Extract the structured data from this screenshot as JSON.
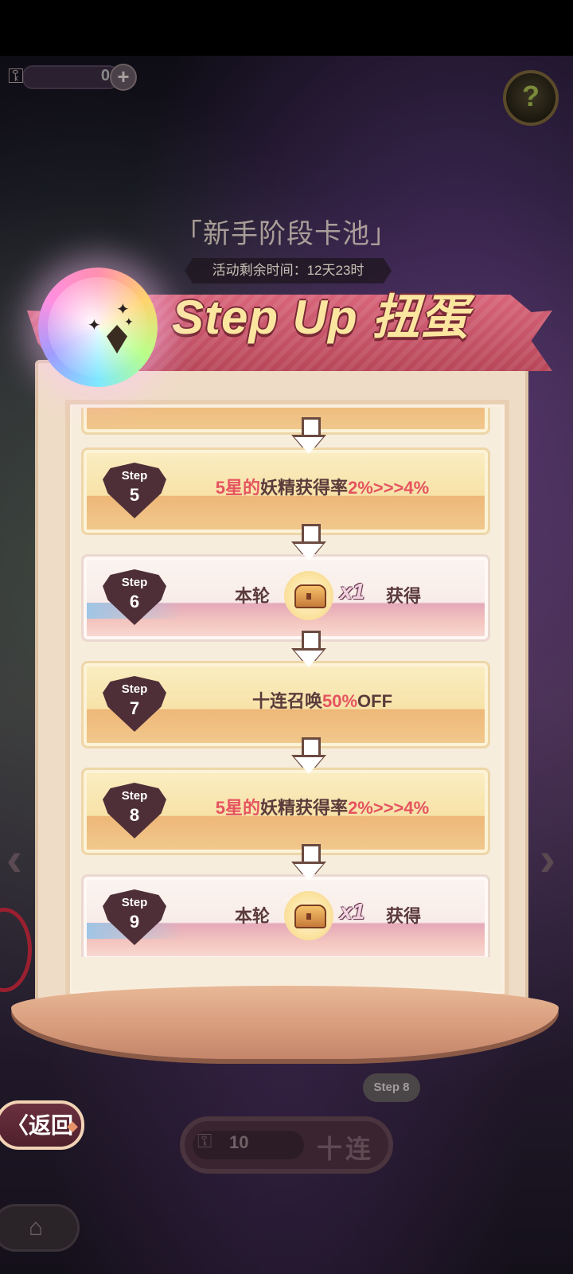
{
  "currency": {
    "count": "0",
    "plus": "+"
  },
  "help_icon": "?",
  "pool": {
    "title": "「新手阶段卡池」",
    "timer": "活动剩余时间：12天23时"
  },
  "banner": {
    "title": "Step Up 扭蛋"
  },
  "steps": [
    {
      "step_label": "Step",
      "number": "5",
      "type": "rate",
      "text_red1": "5星的",
      "text_mid": "妖精获得率",
      "text_red2": "2%>>>4%"
    },
    {
      "step_label": "Step",
      "number": "6",
      "type": "reward",
      "prefix": "本轮",
      "qty": "x1",
      "suffix": "获得"
    },
    {
      "step_label": "Step",
      "number": "7",
      "type": "discount",
      "text_a": "十连召唤",
      "text_red": "50%",
      "text_b": "OFF"
    },
    {
      "step_label": "Step",
      "number": "8",
      "type": "rate",
      "text_red1": "5星的",
      "text_mid": "妖精获得率",
      "text_red2": "2%>>>4%"
    },
    {
      "step_label": "Step",
      "number": "9",
      "type": "reward",
      "prefix": "本轮",
      "qty": "x1",
      "suffix": "获得"
    }
  ],
  "footer": {
    "back_label": "〈返回",
    "current_step_tag": "Step 8",
    "draw_cost": "10",
    "draw_label": "十连"
  },
  "colors": {
    "accent_red": "#e5535f",
    "ribbon": "#c85066",
    "title_gold": "#fbe6a0"
  }
}
